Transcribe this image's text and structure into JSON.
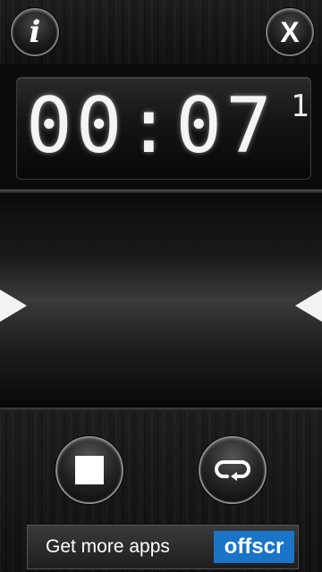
{
  "topbar": {
    "info_label": "i",
    "close_label": "X"
  },
  "display": {
    "time": "00:07",
    "sub_digit": "1"
  },
  "controls": {
    "stop_icon": "stop-square-icon",
    "repeat_icon": "repeat-loop-icon"
  },
  "ad": {
    "text": "Get more apps",
    "logo": "offscr",
    "logo_color": "#1a74c8"
  }
}
